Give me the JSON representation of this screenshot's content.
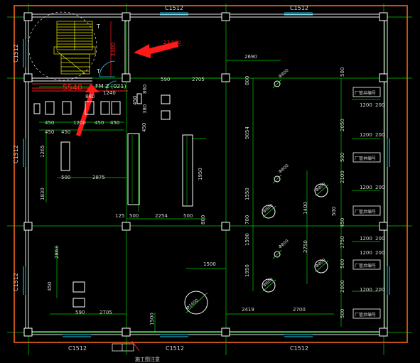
{
  "colors": {
    "background": "#000000",
    "outline": "#ff6a1a",
    "wall": "#ffffff",
    "grid": "#00cc00",
    "dim": "#33ff33",
    "text": "#d8d8d8",
    "annotation": "#ff2020",
    "cyan": "#22ccee",
    "yellow": "#e8e800",
    "marker": "#ff2020"
  },
  "window_labels": {
    "top_left": "C1512",
    "top_right": "C1512",
    "bottom_left": "C1512",
    "bottom_mid": "C1512",
    "bottom_right": "C1512",
    "left_upper": "C1512",
    "left_mid": "C1512",
    "left_lower": "C1512"
  },
  "stair": {
    "dim_vertical": "3300",
    "tag_upper": "T",
    "tag_lower": "T"
  },
  "annotations": {
    "red_dimension": "5540",
    "door_label": "FM Z (021)",
    "ref_elevation": "23.000",
    "dim_1240": "1240",
    "bottom_note": "施工图注意"
  },
  "dims": {
    "d590a": "590",
    "d2705a": "2705",
    "d860": "860",
    "d380": "380",
    "d450a": "450",
    "d450b": "450",
    "d880": "880",
    "d1200": "1200",
    "d450c": "450",
    "d450d": "450",
    "d450e": "450",
    "d450v": "450",
    "d1265": "1265",
    "d500a": "500",
    "d2875": "2875",
    "d1830": "1830",
    "d1950": "1950",
    "d125": "125",
    "d500b": "500",
    "d2254": "2254",
    "d500c": "500",
    "d2690": "2690",
    "d800": "800",
    "d9054": "9054",
    "d1550": "1550",
    "d700": "700",
    "d1590": "1590",
    "d1950b": "1950",
    "d1400": "1400",
    "d2750": "2750",
    "d2863": "2863",
    "d450f": "450",
    "d590b": "590",
    "d2705b": "2705",
    "d1500": "1500",
    "d1500b": "1500",
    "d2419": "2419",
    "d2700": "2700",
    "d500r1": "500",
    "d2050": "2050",
    "d2100": "2100",
    "d450r": "450",
    "d1750": "1750",
    "d2000": "2000",
    "d500r2": "500",
    "d500r3": "500",
    "d500r4": "500",
    "d500r5": "500",
    "d1200a": "1200",
    "d200a": "200",
    "d1200b": "1200",
    "d200b": "200",
    "d1200c": "1200",
    "d200c": "200",
    "d1200d": "1200",
    "d200d": "200",
    "d1200e": "1200",
    "d200e": "200",
    "d1200f": "1200",
    "d200f": "200"
  },
  "equipment_labels": [
    "厂管井编号",
    "厂管井编号",
    "厂管井编号",
    "厂管井编号",
    "厂管井编号",
    "厂管井编号"
  ],
  "circle_tags": {
    "c1": "Φ800",
    "c2": "Φ800",
    "c3": "Φ800",
    "c4": "Φ800",
    "c5": "Φ800",
    "c6": "Φ800",
    "c7": "Φ800",
    "big": "Φ1400"
  }
}
